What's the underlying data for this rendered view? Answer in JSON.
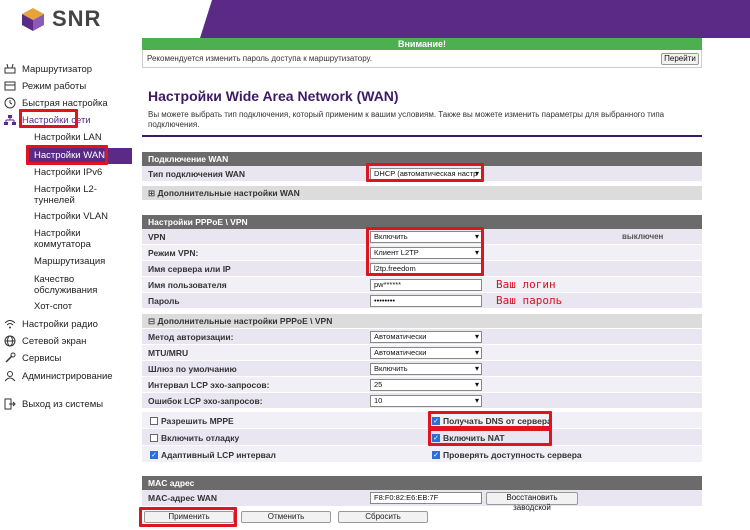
{
  "brand": {
    "name": "SNR"
  },
  "sidebar": {
    "items": [
      {
        "label": "Маршрутизатор",
        "icon": "router-icon"
      },
      {
        "label": "Режим работы",
        "icon": "mode-icon"
      },
      {
        "label": "Быстрая настройка",
        "icon": "clock-icon"
      },
      {
        "label": "Настройки сети",
        "icon": "network-icon"
      },
      {
        "label": "Настройки радио",
        "icon": "wifi-icon"
      },
      {
        "label": "Сетевой экран",
        "icon": "firewall-icon"
      },
      {
        "label": "Сервисы",
        "icon": "wrench-icon"
      },
      {
        "label": "Администрирование",
        "icon": "admin-icon"
      },
      {
        "label": "Выход из системы",
        "icon": "logout-icon"
      }
    ],
    "subitems": [
      "Настройки LAN",
      "Настройки WAN",
      "Настройки IPv6",
      "Настройки L2-туннелей",
      "Настройки VLAN",
      "Настройки коммутатора",
      "Маршрутизация",
      "Качество обслуживания",
      "Хот-спот"
    ]
  },
  "notice": {
    "title": "Внимание!",
    "text": "Рекомендуется изменить пароль доступа к маршрутизатору.",
    "button": "Перейти"
  },
  "page": {
    "title": "Настройки Wide Area Network (WAN)",
    "description": "Вы можете выбрать тип подключения, который применим к вашим условиям. Также вы можете изменить параметры для выбранного типа подключения."
  },
  "wan": {
    "header": "Подключение WAN",
    "type_label": "Тип подключения WAN",
    "type_value": "DHCP (автоматическая настр",
    "advanced": "Дополнительные настройки WAN"
  },
  "pppoe": {
    "header": "Настройки PPPoE \\ VPN",
    "vpn_label": "VPN",
    "vpn_value": "Включить",
    "vpn_status": "выключен",
    "mode_label": "Режим VPN:",
    "mode_value": "Клиент L2TP",
    "server_label": "Имя сервера или IP",
    "server_value": "l2tp.freedom",
    "user_label": "Имя пользователя",
    "user_value": "pw******",
    "pass_label": "Пароль",
    "pass_value": "••••••••",
    "annot_login": "Ваш логин",
    "annot_pass": "Ваш пароль"
  },
  "pppoe_adv": {
    "header": "Дополнительные настройки PPPoE \\ VPN",
    "auth_label": "Метод авторизации:",
    "auth_value": "Автоматически",
    "mtu_label": "MTU/MRU",
    "mtu_value": "Автоматически",
    "gw_label": "Шлюз по умолчанию",
    "gw_value": "Включить",
    "lcp_int_label": "Интервал LCP эхо-запросов:",
    "lcp_int_value": "25",
    "lcp_err_label": "Ошибок LCP эхо-запросов:",
    "lcp_err_value": "10"
  },
  "checkboxes": {
    "mppe": "Разрешить MPPE",
    "debug": "Включить отладку",
    "adaptive": "Адаптивный LCP интервал",
    "dns": "Получать DNS от сервера",
    "nat": "Включить NAT",
    "check": "Проверять доступность сервера"
  },
  "mac": {
    "header": "MAC адрес",
    "label": "MAC-адрес WAN",
    "value": "F8:F0:82:E6:EB:7F",
    "restore": "Восстановить заводской"
  },
  "actions": {
    "apply": "Применить",
    "cancel": "Отменить",
    "reset": "Сбросить"
  },
  "colors": {
    "accent": "#5b2a86",
    "highlight": "#e0141e",
    "notice": "#4caf50"
  }
}
